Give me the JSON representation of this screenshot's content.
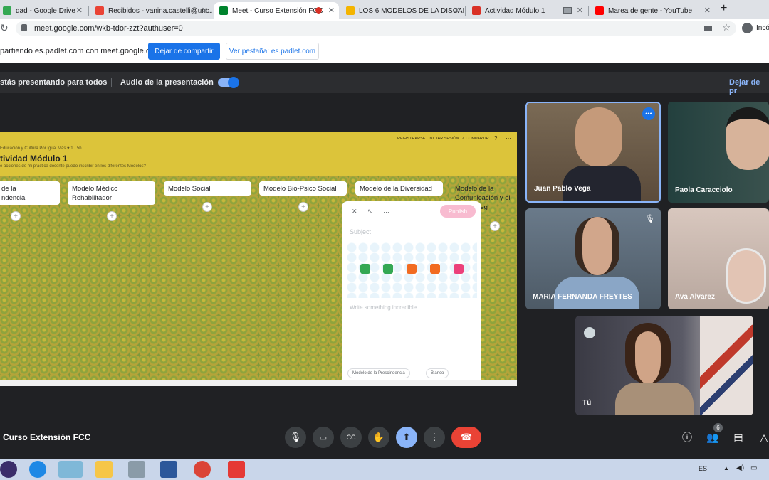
{
  "tabs": [
    {
      "title": "dad - Google Drive",
      "icon": "drive-icon",
      "color": "#34a853"
    },
    {
      "title": "Recibidos - vanina.castelli@unc...",
      "icon": "gmail-icon",
      "color": "#ea4335"
    },
    {
      "title": "Meet - Curso Extensión FCC",
      "icon": "meet-icon",
      "color": "#00832d",
      "active": true
    },
    {
      "title": "LOS 6 MODELOS DE LA DISCAP...",
      "icon": "slides-icon",
      "color": "#f4b400"
    },
    {
      "title": "Actividad Módulo 1",
      "icon": "padlet-icon",
      "color": "#d93025"
    },
    {
      "title": "",
      "icon": "window-icon",
      "color": "#5f6368"
    },
    {
      "title": "Marea de gente - YouTube",
      "icon": "youtube-icon",
      "color": "#ff0000"
    }
  ],
  "new_tab": "+",
  "address": {
    "url": "meet.google.com/wkb-tdor-zzt?authuser=0",
    "profile": "Incó"
  },
  "share_bar": {
    "text": "partiendo es.padlet.com con meet.google.com",
    "stop_label": "Dejar de compartir",
    "view_label": "Ver pestaña: es.padlet.com"
  },
  "present_bar": {
    "text": "stás presentando para todos",
    "audio_label": "Audio de la presentación",
    "stop_label": "Dejar de pr"
  },
  "padlet": {
    "breadcrumb": "Educación y Cultura Por Igual Más  ♥ 1  ·  5h",
    "title": "tividad Módulo 1",
    "subtitle": "é acciones de mi práctica docente puedo inscribir en los diferentes Modelos?",
    "top_links": [
      "REGISTRARSE",
      "INICIAR SESIÓN",
      "↗ COMPARTIR",
      "?",
      "⋯"
    ],
    "columns": [
      "de la\nndencia",
      "Modelo Médico\nRehabilitador",
      "Modelo Social",
      "Modelo Bio-Psico Social",
      "Modelo de la Diversidad",
      "Modelo de la\nComunicación y el\nimiento leg"
    ],
    "composer": {
      "publish": "Publish",
      "subject": "Subject",
      "body": "Write something incredible...",
      "tag1": "Modelo de la Prescindencia",
      "tag2": "Blanco",
      "tools": [
        "✕",
        "↖",
        "…"
      ]
    }
  },
  "participants": [
    {
      "name": "Juan Pablo Vega",
      "bg": "#6b5a48",
      "skin": "#c59a7a"
    },
    {
      "name": "Paola Caracciolo",
      "bg": "#2e4a48",
      "skin": "#d7b39a"
    },
    {
      "name": "MARIA FERNANDA FREYTES",
      "bg": "#5a6a7a",
      "skin": "#d1a68b"
    },
    {
      "name": "Ava Alvarez",
      "bg": "#c9b8b0",
      "skin": "#e2c4b4"
    },
    {
      "name": "Tú",
      "bg": "#4a4a52",
      "skin": "#d0a487"
    }
  ],
  "meeting": {
    "title": "Curso Extensión FCC",
    "people_count": "6"
  },
  "controls": [
    "mic-icon",
    "camera-icon",
    "captions-icon",
    "raise-hand-icon",
    "present-icon",
    "more-icon",
    "end-call-icon"
  ],
  "taskbar": {
    "lang": "ES"
  }
}
